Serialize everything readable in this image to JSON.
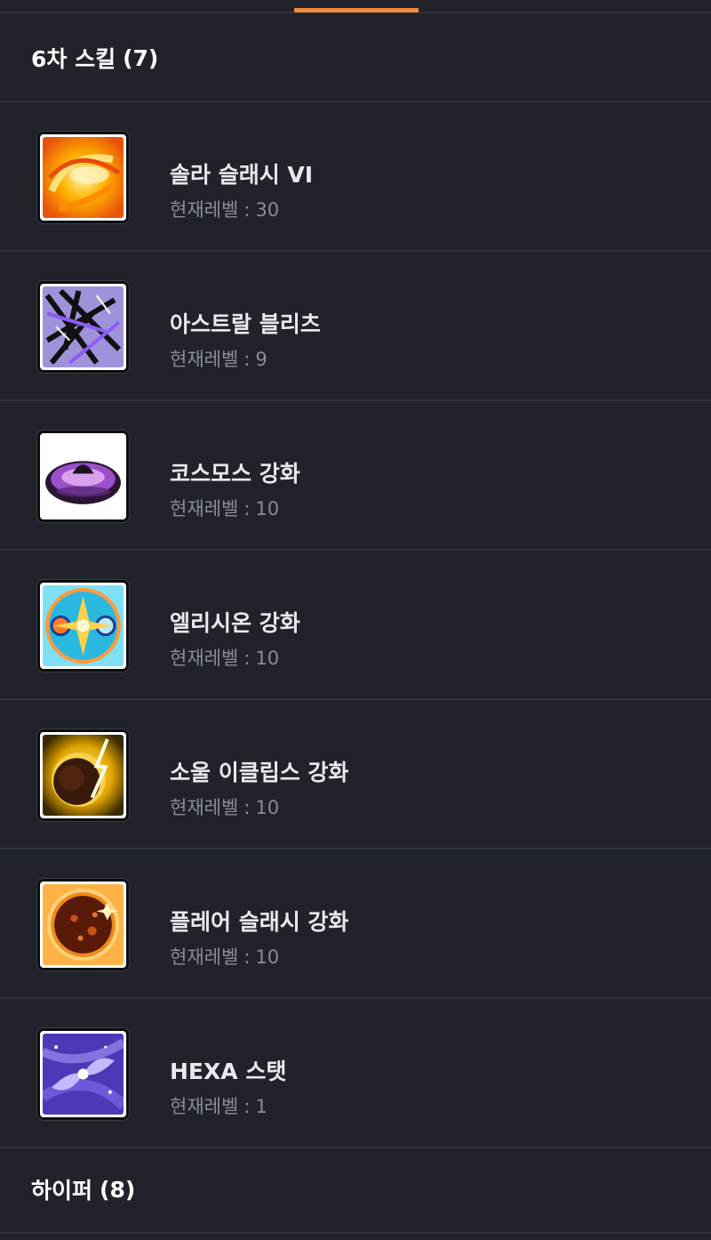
{
  "tabs": {
    "active_indicator_color": "#f08a3c"
  },
  "sections": [
    {
      "title": "6차 스킬",
      "count": "(7)"
    },
    {
      "title": "하이퍼",
      "count": "(8)"
    }
  ],
  "level_prefix": "현재레벨",
  "level_separator": ":",
  "skills": [
    {
      "name": "솔라 슬래시 VI",
      "level": "30",
      "icon": "solar-slash-icon"
    },
    {
      "name": "아스트랄 블리츠",
      "level": "9",
      "icon": "astral-blitz-icon"
    },
    {
      "name": "코스모스 강화",
      "level": "10",
      "icon": "cosmos-icon"
    },
    {
      "name": "엘리시온 강화",
      "level": "10",
      "icon": "elysion-icon"
    },
    {
      "name": "소울 이클립스 강화",
      "level": "10",
      "icon": "soul-eclipse-icon"
    },
    {
      "name": "플레어 슬래시 강화",
      "level": "10",
      "icon": "flare-slash-icon"
    },
    {
      "name": "HEXA 스탯",
      "level": "1",
      "icon": "hexa-stat-icon"
    }
  ]
}
